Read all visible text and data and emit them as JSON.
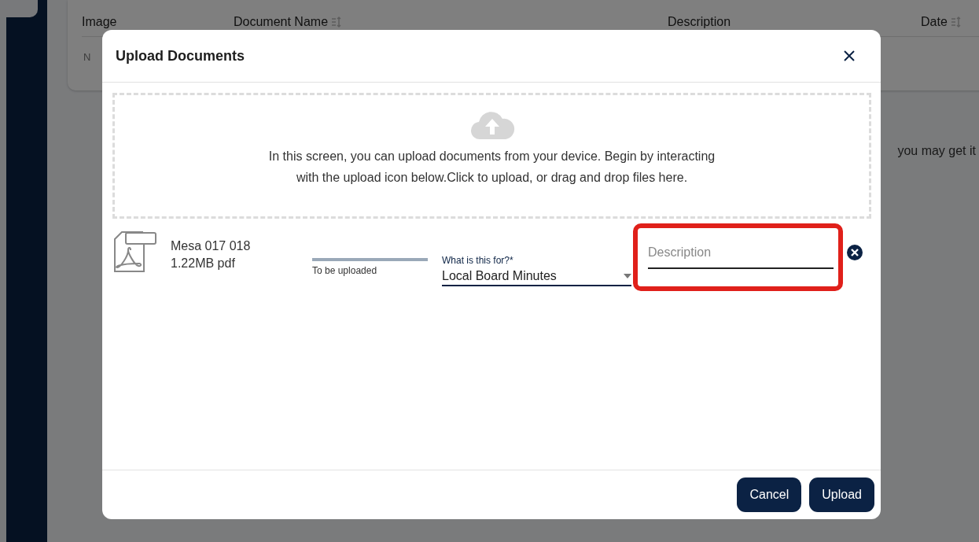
{
  "background": {
    "table": {
      "columns": [
        {
          "label": "Image",
          "sortable": false
        },
        {
          "label": "Document Name",
          "sortable": true
        },
        {
          "label": "Description",
          "sortable": false
        },
        {
          "label": "Date",
          "sortable": true
        }
      ],
      "empty_text": "N"
    },
    "side_text": "you may get it"
  },
  "dialog": {
    "title": "Upload Documents",
    "dropzone": {
      "text": "In this screen, you can upload documents from your device. Begin by interacting with the upload icon below.Click to upload, or drag and drop files here."
    },
    "files": [
      {
        "name": "Mesa 017 018",
        "size": "1.22MB pdf",
        "progress": {
          "level": 1,
          "status": "To be uploaded"
        },
        "purpose": {
          "label": "What is this for?*",
          "value": "Local Board Minutes"
        },
        "description": {
          "placeholder": "Description",
          "highlighted": true
        }
      }
    ],
    "buttons": [
      {
        "label": "Cancel"
      },
      {
        "label": "Upload"
      }
    ]
  }
}
